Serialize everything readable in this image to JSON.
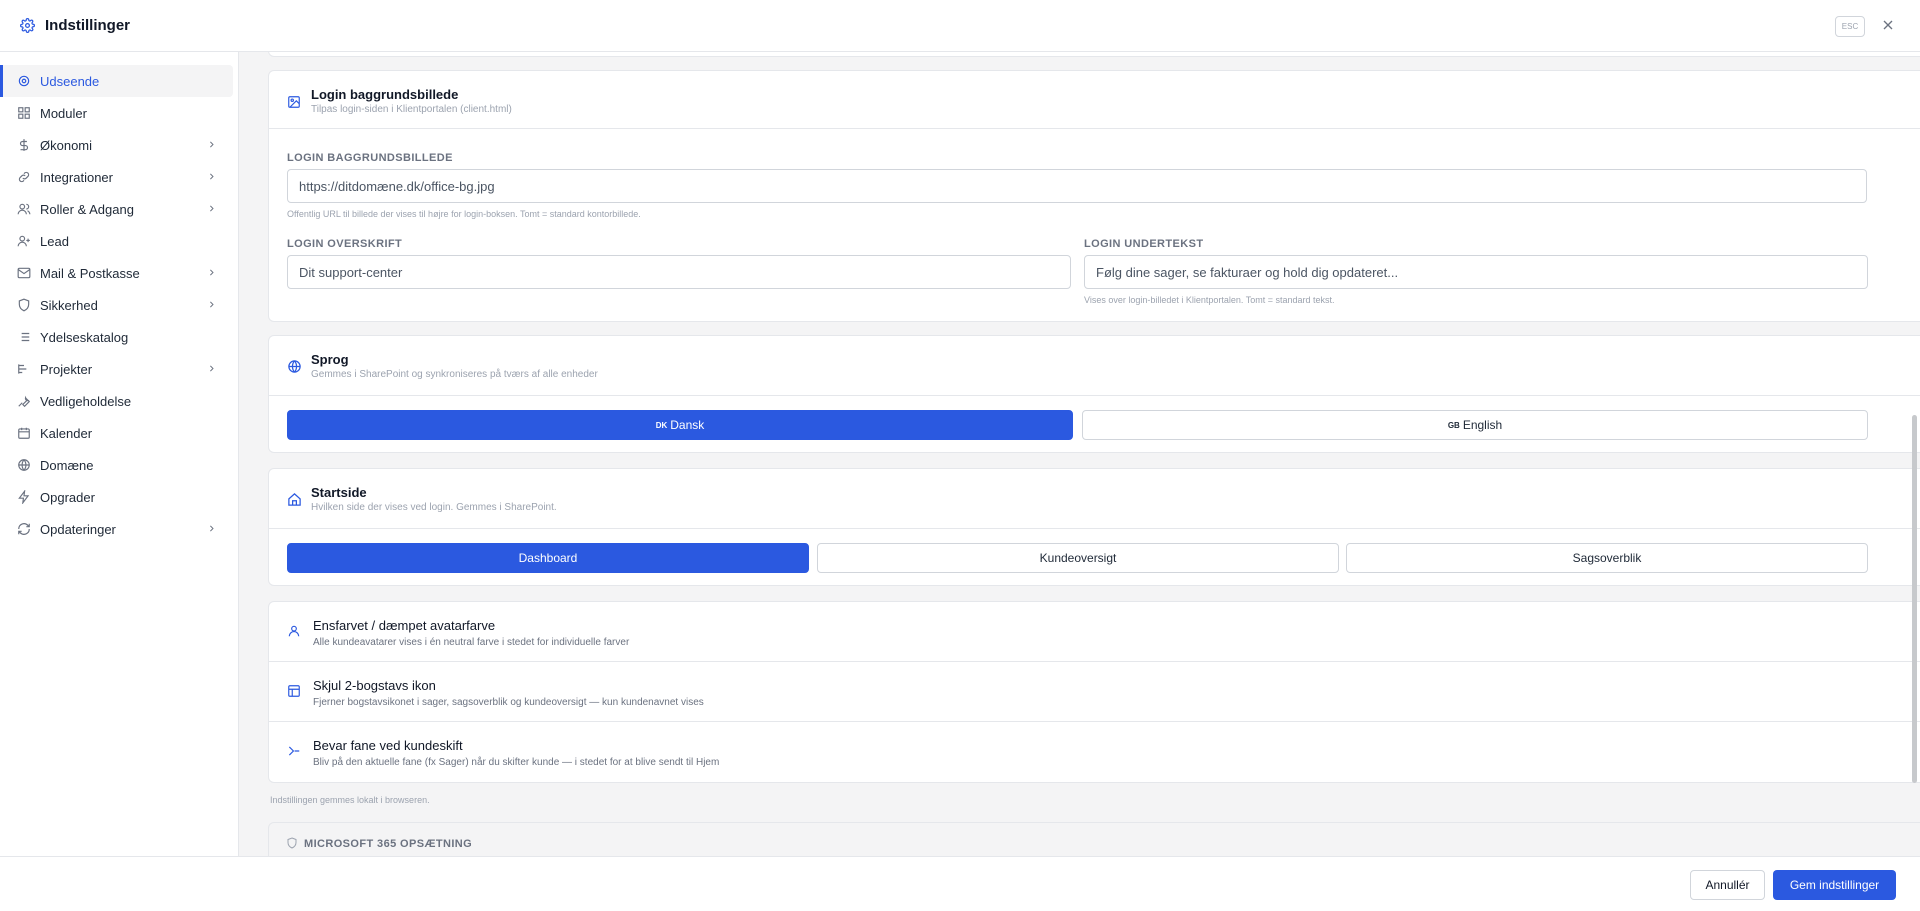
{
  "header": {
    "title": "Indstillinger",
    "esc_label": "ESC"
  },
  "sidebar": {
    "items": [
      {
        "label": "Udseende",
        "icon": "gear-icon",
        "active": true
      },
      {
        "label": "Moduler",
        "icon": "grid-icon"
      },
      {
        "label": "Økonomi",
        "icon": "dollar-icon",
        "expandable": true
      },
      {
        "label": "Integrationer",
        "icon": "link-icon",
        "expandable": true
      },
      {
        "label": "Roller & Adgang",
        "icon": "users-icon",
        "expandable": true
      },
      {
        "label": "Lead",
        "icon": "user-plus-icon"
      },
      {
        "label": "Mail & Postkasse",
        "icon": "mail-icon",
        "expandable": true
      },
      {
        "label": "Sikkerhed",
        "icon": "shield-icon",
        "expandable": true
      },
      {
        "label": "Ydelseskatalog",
        "icon": "list-icon"
      },
      {
        "label": "Projekter",
        "icon": "projects-icon",
        "expandable": true
      },
      {
        "label": "Vedligeholdelse",
        "icon": "wrench-icon"
      },
      {
        "label": "Kalender",
        "icon": "calendar-icon"
      },
      {
        "label": "Domæne",
        "icon": "globe-icon"
      },
      {
        "label": "Opgrader",
        "icon": "bolt-icon"
      },
      {
        "label": "Opdateringer",
        "icon": "refresh-icon",
        "expandable": true
      }
    ]
  },
  "login_bg": {
    "title": "Login baggrundsbillede",
    "subtitle": "Tilpas login-siden i Klientportalen (client.html)",
    "url_label": "LOGIN BAGGRUNDSBILLEDE",
    "url_placeholder": "https://ditdomæne.dk/office-bg.jpg",
    "url_hint": "Offentlig URL til billede der vises til højre for login-boksen. Tomt = standard kontorbillede.",
    "heading_label": "LOGIN OVERSKRIFT",
    "heading_placeholder": "Dit support-center",
    "subtext_label": "LOGIN UNDERTEKST",
    "subtext_placeholder": "Følg dine sager, se fakturaer og hold dig opdateret...",
    "subtext_hint": "Vises over login-billedet i Klientportalen. Tomt = standard tekst."
  },
  "language": {
    "title": "Sprog",
    "subtitle": "Gemmes i SharePoint og synkroniseres på tværs af alle enheder",
    "options": [
      {
        "flag": "DK",
        "label": "Dansk",
        "selected": true
      },
      {
        "flag": "GB",
        "label": "English",
        "selected": false
      }
    ]
  },
  "startpage": {
    "title": "Startside",
    "subtitle": "Hvilken side der vises ved login. Gemmes i SharePoint.",
    "options": [
      {
        "label": "Dashboard",
        "selected": true
      },
      {
        "label": "Kundeoversigt",
        "selected": false
      },
      {
        "label": "Sagsoverblik",
        "selected": false
      }
    ]
  },
  "toggles": [
    {
      "title": "Ensfarvet / dæmpet avatarfarve",
      "subtitle": "Alle kundeavatarer vises i én neutral farve i stedet for individuelle farver",
      "on": false,
      "icon": "user-icon"
    },
    {
      "title": "Skjul 2-bogstavs ikon",
      "subtitle": "Fjerner bogstavsikonet i sager, sagsoverblik og kundeoversigt — kun kundenavnet vises",
      "on": true,
      "icon": "layout-icon"
    },
    {
      "title": "Bevar fane ved kundeskift",
      "subtitle": "Bliv på den aktuelle fane (fx Sager) når du skifter kunde — i stedet for at blive sendt til Hjem",
      "on": false,
      "icon": "arrow-right-icon"
    }
  ],
  "toggles_note": "Indstillingen gemmes lokalt i browseren.",
  "ms365": {
    "title": "MICROSOFT 365 OPSÆTNING"
  },
  "footer": {
    "cancel_label": "Annullér",
    "save_label": "Gem indstillinger"
  },
  "colors": {
    "accent": "#2b59e0",
    "border": "#e5e7eb",
    "muted": "#9ca3af"
  }
}
